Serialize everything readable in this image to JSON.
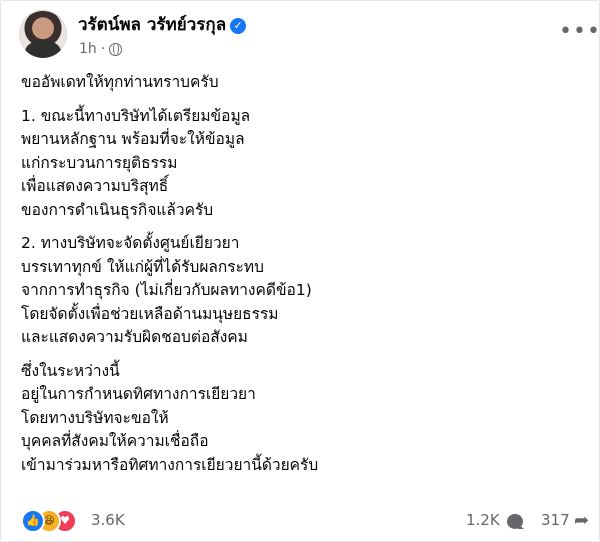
{
  "post": {
    "author": "วรัตน์พล วรัทย์วรกุล",
    "time": "1h",
    "paragraphs": [
      [
        "ขออัพเดทให้ทุกท่านทราบครับ"
      ],
      [
        "1. ขณะนี้ทางบริษัทได้เตรียมข้อมูล",
        "พยานหลักฐาน พร้อมที่จะให้ข้อมูล",
        "แก่กระบวนการยุติธรรม",
        "เพื่อแสดงความบริสุทธิ์",
        "ของการดำเนินธุรกิจแล้วครับ"
      ],
      [
        "2. ทางบริษัทจะจัดตั้งศูนย์เยียวยา",
        "บรรเทาทุกข์ ให้แก่ผู้ที่ได้รับผลกระทบ",
        "จากการทำธุรกิจ (ไม่เกี่ยวกับผลทางคดีข้อ1)",
        "โดยจัดตั้งเพื่อช่วยเหลือด้านมนุษยธรรม",
        "และแสดงความรับผิดชอบต่อสังคม"
      ],
      [
        "ซึ่งในระหว่างนี้",
        "อยู่ในการกำหนดทิศทางการเยียวยา",
        "โดยทางบริษัทจะขอให้",
        "บุคคลที่สังคมให้ความเชื่อถือ",
        "เข้ามาร่วมหารือทิศทางการเยียวยานี้ด้วยครับ"
      ]
    ]
  },
  "footer": {
    "reactions_count": "3.6K",
    "comments_count": "1.2K",
    "shares_count": "317"
  },
  "icons": {
    "verified": "verified-badge-icon",
    "privacy": "globe-icon",
    "more": "more-options-icon",
    "comment": "comment-icon",
    "share": "share-icon"
  },
  "colors": {
    "accent": "#1877f2",
    "secondary_text": "#65676b"
  }
}
